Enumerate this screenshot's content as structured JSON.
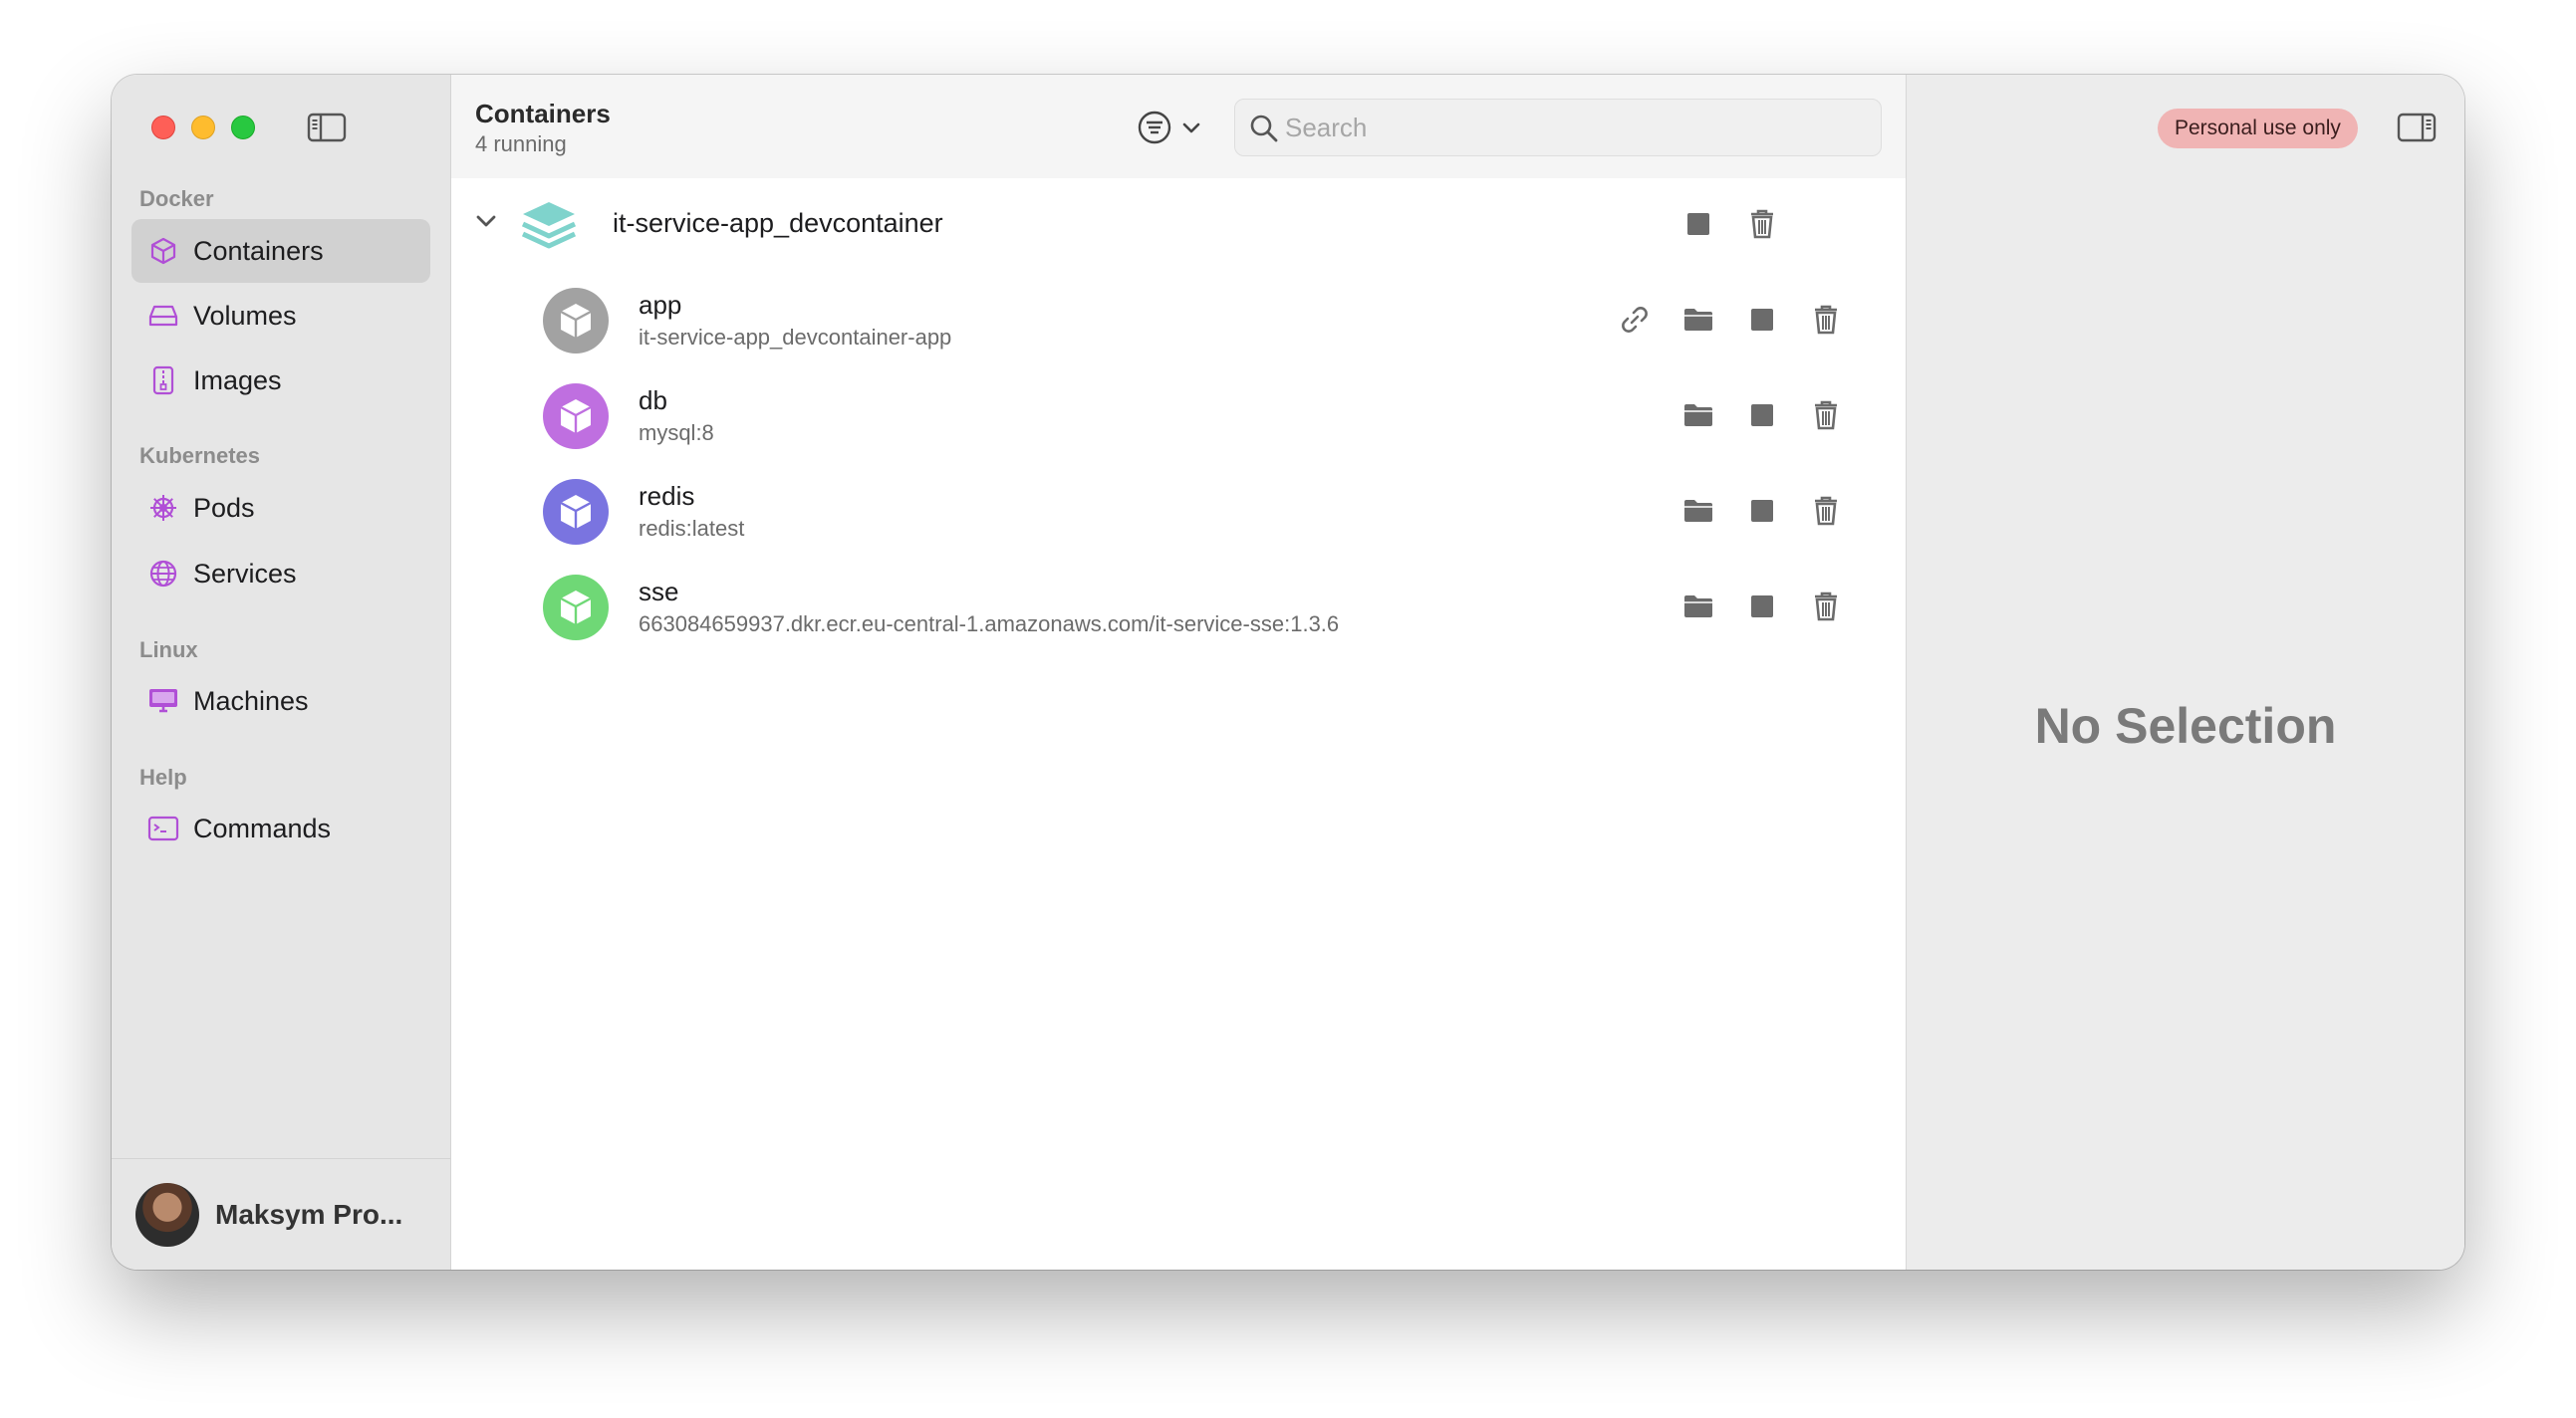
{
  "sidebar": {
    "sections": [
      {
        "label": "Docker",
        "items": [
          {
            "label": "Containers",
            "icon": "cube-icon",
            "active": true
          },
          {
            "label": "Volumes",
            "icon": "drive-icon",
            "active": false
          },
          {
            "label": "Images",
            "icon": "archive-icon",
            "active": false
          }
        ]
      },
      {
        "label": "Kubernetes",
        "items": [
          {
            "label": "Pods",
            "icon": "helm-icon",
            "active": false
          },
          {
            "label": "Services",
            "icon": "globe-icon",
            "active": false
          }
        ]
      },
      {
        "label": "Linux",
        "items": [
          {
            "label": "Machines",
            "icon": "monitor-icon",
            "active": false
          }
        ]
      },
      {
        "label": "Help",
        "items": [
          {
            "label": "Commands",
            "icon": "terminal-icon",
            "active": false
          }
        ]
      }
    ],
    "user": {
      "name": "Maksym Pro..."
    }
  },
  "toolbar": {
    "title": "Containers",
    "subtitle": "4 running",
    "search_placeholder": "Search"
  },
  "group": {
    "name": "it-service-app_devcontainer"
  },
  "containers": [
    {
      "name": "app",
      "image": "it-service-app_devcontainer-app",
      "color": "#a2a2a2",
      "has_link": true
    },
    {
      "name": "db",
      "image": "mysql:8",
      "color": "#bf6fe0",
      "has_link": false
    },
    {
      "name": "redis",
      "image": "redis:latest",
      "color": "#7a74e0",
      "has_link": false
    },
    {
      "name": "sse",
      "image": "663084659937.dkr.ecr.eu-central-1.amazonaws.com/it-service-sse:1.3.6",
      "color": "#6fd876",
      "has_link": false
    }
  ],
  "detail": {
    "badge": "Personal use only",
    "empty_text": "No Selection"
  },
  "colors": {
    "accent": "#b04fd6",
    "stack_icon": "#7fd3cc",
    "action_icon": "#6b6b6b"
  }
}
